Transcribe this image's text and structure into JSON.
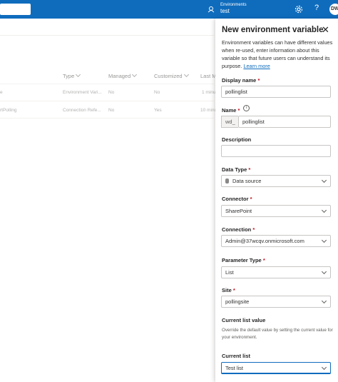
{
  "topbar": {
    "environment_label": "Environments",
    "environment_name": "test",
    "user_initials": "DW"
  },
  "table": {
    "headers": [
      {
        "label": "Type"
      },
      {
        "label": "Managed"
      },
      {
        "label": "Customized"
      },
      {
        "label": "Last M"
      }
    ],
    "rows": [
      {
        "name": "e",
        "type": "Environment Vari...",
        "managed": "No",
        "customized": "No",
        "modified": "1 minut"
      },
      {
        "name": "rtPolling",
        "type": "Connection Refe...",
        "managed": "No",
        "customized": "Yes",
        "modified": "10 minu"
      }
    ]
  },
  "panel": {
    "title": "New environment variable",
    "description": "Environment variables can have different values when re-used, enter information about this variable so that future users can understand its purpose.",
    "learn_more": "Learn more",
    "display_name": {
      "label": "Display name",
      "value": "pollinglist"
    },
    "name": {
      "label": "Name",
      "prefix": "wd_",
      "value": "pollinglist"
    },
    "description_field": {
      "label": "Description",
      "value": ""
    },
    "data_type": {
      "label": "Data Type",
      "value": "Data source"
    },
    "connector": {
      "label": "Connector",
      "value": "SharePoint"
    },
    "connection": {
      "label": "Connection",
      "value": "Admin@37wcqv.onmicrosoft.com"
    },
    "parameter_type": {
      "label": "Parameter Type",
      "value": "List"
    },
    "site": {
      "label": "Site",
      "value": "pollingsite"
    },
    "current_list_value": {
      "label": "Current list value",
      "hint": "Override the default value by setting the current value for your environment."
    },
    "current_list": {
      "label": "Current list",
      "value": "Test list"
    },
    "required_mark": "*"
  },
  "colors": {
    "brand": "#0f6cbd",
    "required": "#c50f1f"
  }
}
